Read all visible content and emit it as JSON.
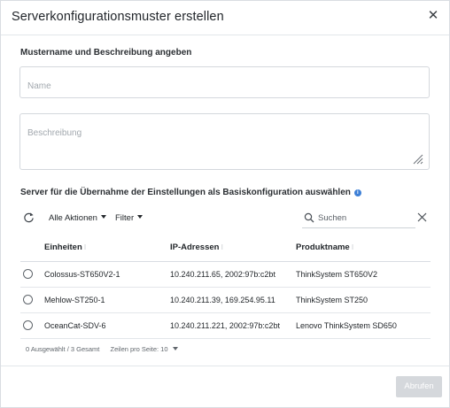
{
  "dialog": {
    "title": "Serverkonfigurationsmuster erstellen",
    "close_icon": "close-icon"
  },
  "pattern_section": {
    "heading": "Mustername und Beschreibung angeben",
    "name_placeholder": "Name",
    "name_value": "",
    "description_placeholder": "Beschreibung",
    "description_value": ""
  },
  "server_section": {
    "heading": "Server für die Übernahme der Einstellungen als Basiskonfiguration auswählen",
    "info_icon": "info-icon"
  },
  "toolbar": {
    "refresh_icon": "refresh-icon",
    "all_actions_label": "Alle Aktionen",
    "filter_label": "Filter",
    "search_placeholder": "Suchen",
    "search_value": "",
    "clear_icon": "clear-icon"
  },
  "table": {
    "columns": [
      "Einheiten",
      "IP-Adressen",
      "Produktname"
    ],
    "sort_glyph": "⁝",
    "rows": [
      {
        "device": "Colossus-ST650V2-1",
        "ip": "10.240.211.65, 2002:97b:c2bt",
        "product": "ThinkSystem ST650V2",
        "selected": false
      },
      {
        "device": "Mehlow-ST250-1",
        "ip": "10.240.211.39, 169.254.95.11",
        "product": "ThinkSystem ST250",
        "selected": false
      },
      {
        "device": "OceanCat-SDV-6",
        "ip": "10.240.211.221, 2002:97b:c2bt",
        "product": "Lenovo ThinkSystem SD650",
        "selected": false
      }
    ]
  },
  "footer": {
    "selection_status": "0 Ausgewählt / 3 Gesamt",
    "rows_per_page_label": "Zeilen pro Seite: 10"
  },
  "actions": {
    "apply_label": "Abrufen",
    "apply_enabled": false
  },
  "colors": {
    "accent_info": "#3d7fd6",
    "disabled_button": "#d5d8dc",
    "border": "#d4d8dd"
  }
}
